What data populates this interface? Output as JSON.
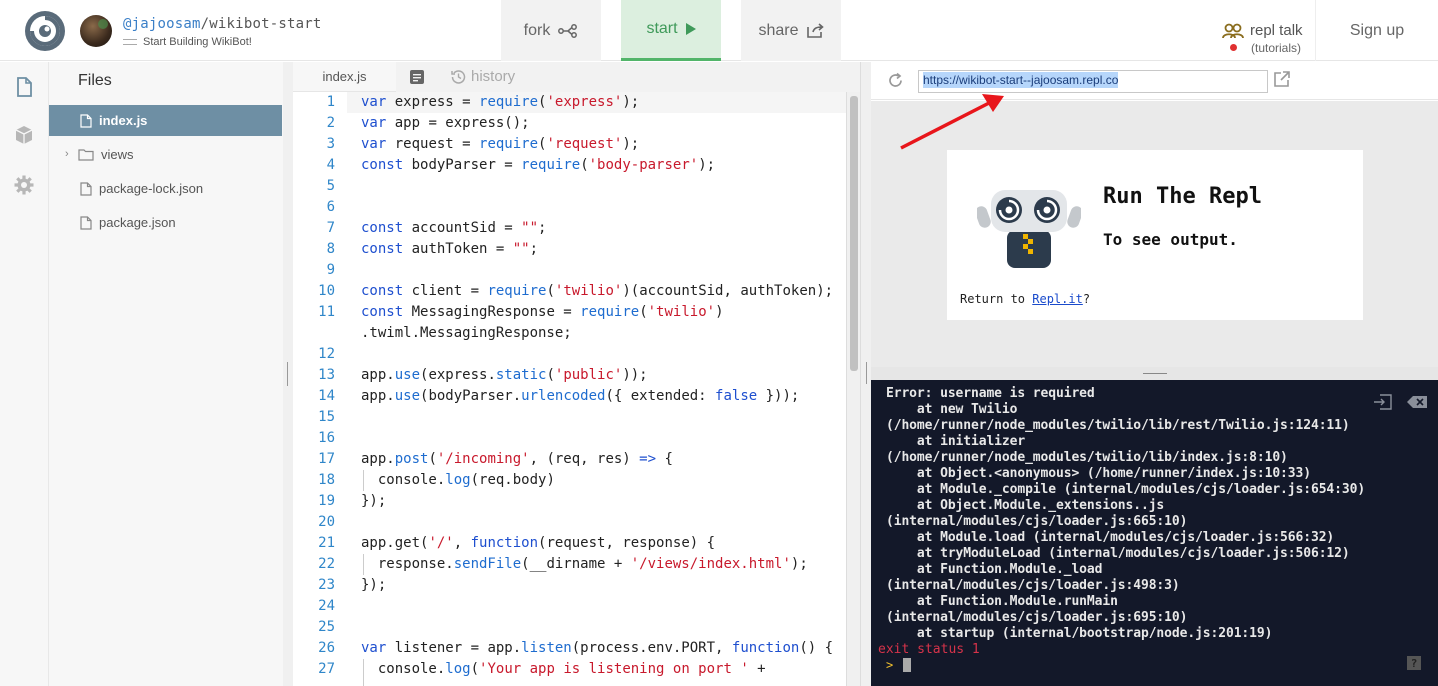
{
  "header": {
    "user_handle": "@jajoosam",
    "repl_slug": "/wikibot-start",
    "repl_description": "Start Building WikiBot!",
    "fork_label": "fork",
    "start_label": "start",
    "share_label": "share",
    "repl_talk_label": "repl talk",
    "repl_talk_sub": "(tutorials)",
    "signup_label": "Sign up"
  },
  "files": {
    "title": "Files",
    "items": [
      {
        "label": "index.js",
        "type": "file",
        "active": true
      },
      {
        "label": "views",
        "type": "folder",
        "active": false
      },
      {
        "label": "package-lock.json",
        "type": "file",
        "active": false
      },
      {
        "label": "package.json",
        "type": "file",
        "active": false
      }
    ]
  },
  "editor": {
    "tab_label": "index.js",
    "history_label": "history",
    "line_numbers": [
      "1",
      "2",
      "3",
      "4",
      "5",
      "6",
      "7",
      "8",
      "9",
      "10",
      "11",
      "",
      "12",
      "13",
      "14",
      "15",
      "16",
      "17",
      "18",
      "19",
      "20",
      "21",
      "22",
      "23",
      "24",
      "25",
      "26",
      "27"
    ]
  },
  "webview": {
    "url": "https://wikibot-start--jajoosam.repl.co",
    "card_title": "Run The Repl",
    "card_subtitle": "To see output.",
    "return_prefix": "Return to ",
    "return_link": "Repl.it",
    "return_suffix": "?"
  },
  "console": {
    "lines": [
      "Error: username is required",
      "    at new Twilio",
      "(/home/runner/node_modules/twilio/lib/rest/Twilio.js:124:11)",
      "    at initializer",
      "(/home/runner/node_modules/twilio/lib/index.js:8:10)",
      "    at Object.<anonymous> (/home/runner/index.js:10:33)",
      "    at Module._compile (internal/modules/cjs/loader.js:654:30)",
      "    at Object.Module._extensions..js",
      "(internal/modules/cjs/loader.js:665:10)",
      "    at Module.load (internal/modules/cjs/loader.js:566:32)",
      "    at tryModuleLoad (internal/modules/cjs/loader.js:506:12)",
      "    at Function.Module._load",
      "(internal/modules/cjs/loader.js:498:3)",
      "    at Function.Module.runMain",
      "(internal/modules/cjs/loader.js:695:10)",
      "    at startup (internal/bootstrap/node.js:201:19)"
    ],
    "exit_status": "exit status 1",
    "prompt": ">",
    "help_label": "?"
  },
  "colors": {
    "accent_green": "#52b56a",
    "active_file_bg": "#6e8fa4",
    "console_bg": "#131829",
    "annotation_red": "#e8161b"
  }
}
